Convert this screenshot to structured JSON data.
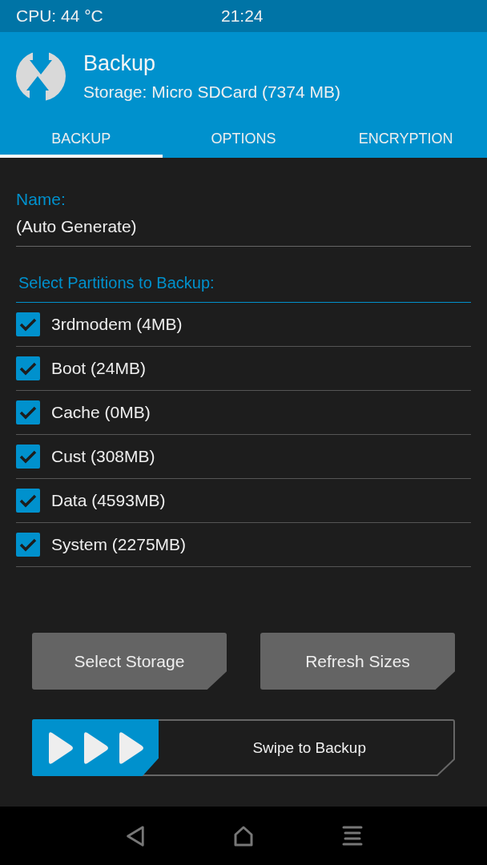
{
  "status_bar": {
    "cpu": "CPU: 44 °C",
    "time": "21:24"
  },
  "header": {
    "title": "Backup",
    "subtitle": "Storage: Micro SDCard (7374 MB)"
  },
  "tabs": [
    {
      "label": "BACKUP",
      "selected": true
    },
    {
      "label": "OPTIONS",
      "selected": false
    },
    {
      "label": "ENCRYPTION",
      "selected": false
    }
  ],
  "name_field": {
    "label": "Name:",
    "value": "(Auto Generate)"
  },
  "partitions_title": "Select Partitions to Backup:",
  "partitions": [
    {
      "label": "3rdmodem (4MB)",
      "checked": true
    },
    {
      "label": "Boot (24MB)",
      "checked": true
    },
    {
      "label": "Cache (0MB)",
      "checked": true
    },
    {
      "label": "Cust (308MB)",
      "checked": true
    },
    {
      "label": "Data (4593MB)",
      "checked": true
    },
    {
      "label": "System (2275MB)",
      "checked": true
    }
  ],
  "buttons": [
    "Select Storage",
    "Refresh Sizes"
  ],
  "swipe": {
    "label": "Swipe to Backup",
    "level": 0.3
  }
}
